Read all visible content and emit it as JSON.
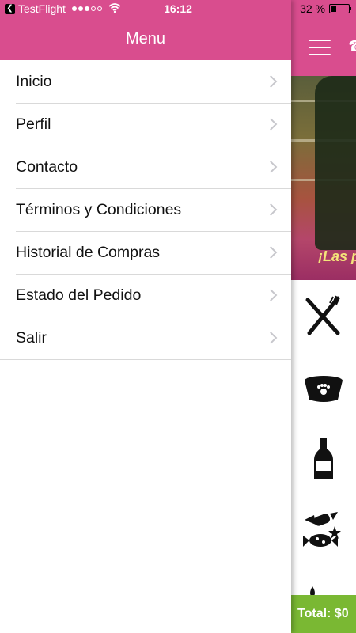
{
  "status_bar": {
    "carrier": "TestFlight",
    "back_icon": "back-arrow-icon",
    "time": "16:12",
    "battery_percent": "32 %",
    "battery_level": 0.32
  },
  "menu": {
    "title": "Menu",
    "items": [
      {
        "label": "Inicio"
      },
      {
        "label": "Perfil"
      },
      {
        "label": "Contacto"
      },
      {
        "label": "Términos y Condiciones"
      },
      {
        "label": "Historial de Compras"
      },
      {
        "label": "Estado del Pedido"
      },
      {
        "label": "Salir"
      }
    ]
  },
  "main": {
    "banner_text": "¡Las p",
    "categories": [
      {
        "icon": "fork-knife-icon"
      },
      {
        "icon": "pet-bowl-icon"
      },
      {
        "icon": "beer-bottle-icon"
      },
      {
        "icon": "candy-icon"
      },
      {
        "icon": "drops-icon"
      }
    ],
    "total_label": "Total: $0"
  },
  "colors": {
    "brand_pink": "#d94d8e",
    "total_green": "#7ab833"
  }
}
